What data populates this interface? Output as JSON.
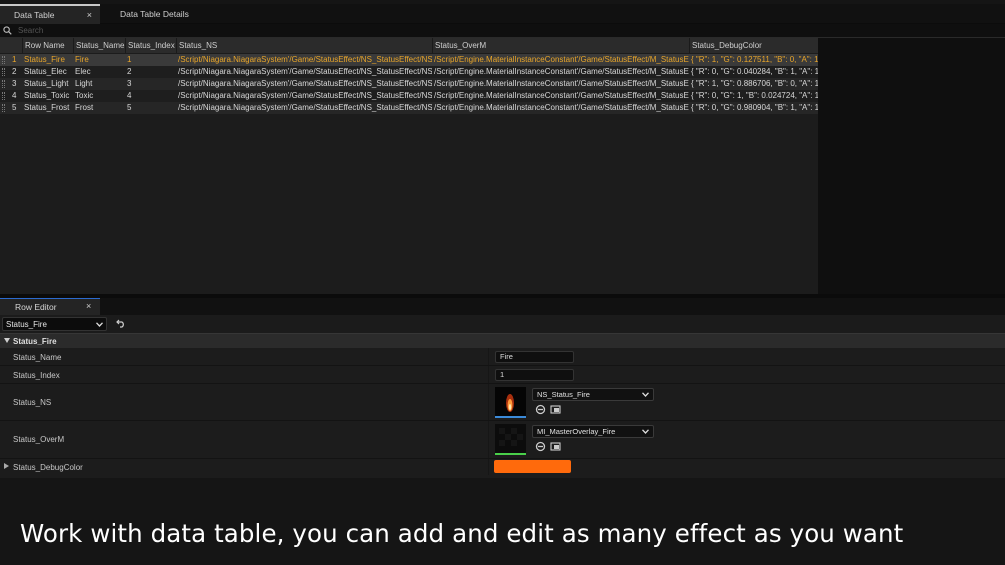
{
  "tabs": [
    {
      "label": "Data Table",
      "active": true,
      "close": "×"
    },
    {
      "label": "Data Table Details",
      "active": false
    }
  ],
  "search": {
    "placeholder": "Search"
  },
  "table": {
    "columns": [
      "Row Name",
      "Status_Name",
      "Status_Index",
      "Status_NS",
      "Status_OverM",
      "Status_DebugColor"
    ],
    "rows": [
      {
        "num": "1",
        "row_name": "Status_Fire",
        "name": "Fire",
        "index": "1",
        "ns": "/Script/Niagara.NiagaraSystem'/Game/StatusEffect/NS_StatusEffect/NS_",
        "overm": "/Script/Engine.MaterialInstanceConstant'/Game/StatusEffect/M_StatusE",
        "color": "{ \"R\": 1, \"G\": 0.127511, \"B\": 0, \"A\": 1 }",
        "selected": true
      },
      {
        "num": "2",
        "row_name": "Status_Elec",
        "name": "Elec",
        "index": "2",
        "ns": "/Script/Niagara.NiagaraSystem'/Game/StatusEffect/NS_StatusEffect/NS_",
        "overm": "/Script/Engine.MaterialInstanceConstant'/Game/StatusEffect/M_StatusE",
        "color": "{ \"R\": 0, \"G\": 0.040284, \"B\": 1, \"A\": 1 }",
        "selected": false
      },
      {
        "num": "3",
        "row_name": "Status_Light",
        "name": "Light",
        "index": "3",
        "ns": "/Script/Niagara.NiagaraSystem'/Game/StatusEffect/NS_StatusEffect/NS_",
        "overm": "/Script/Engine.MaterialInstanceConstant'/Game/StatusEffect/M_StatusE",
        "color": "{ \"R\": 1, \"G\": 0.886706, \"B\": 0, \"A\": 1 }",
        "selected": false
      },
      {
        "num": "4",
        "row_name": "Status_Toxic",
        "name": "Toxic",
        "index": "4",
        "ns": "/Script/Niagara.NiagaraSystem'/Game/StatusEffect/NS_StatusEffect/NS_",
        "overm": "/Script/Engine.MaterialInstanceConstant'/Game/StatusEffect/M_StatusE",
        "color": "{ \"R\": 0, \"G\": 1, \"B\": 0.024724, \"A\": 1 }",
        "selected": false
      },
      {
        "num": "5",
        "row_name": "Status_Frost",
        "name": "Frost",
        "index": "5",
        "ns": "/Script/Niagara.NiagaraSystem'/Game/StatusEffect/NS_StatusEffect/NS_",
        "overm": "/Script/Engine.MaterialInstanceConstant'/Game/StatusEffect/M_StatusE",
        "color": "{ \"R\": 0, \"G\": 0.980904, \"B\": 1, \"A\": 1 }",
        "selected": false
      }
    ]
  },
  "row_editor": {
    "tab_label": "Row Editor",
    "close": "×",
    "selected_row": "Status_Fire",
    "section": "Status_Fire",
    "props": {
      "name_label": "Status_Name",
      "name_value": "Fire",
      "index_label": "Status_Index",
      "index_value": "1",
      "ns_label": "Status_NS",
      "ns_value": "NS_Status_Fire",
      "overm_label": "Status_OverM",
      "overm_value": "MI_MasterOverlay_Fire",
      "color_label": "Status_DebugColor"
    }
  },
  "colors": {
    "accent_selected": "#e9a62a",
    "debug_color": "#ff6a0c",
    "tab_underline": "#2c6bd0"
  },
  "caption": "Work with data table, you can add and edit as many effect as you want"
}
